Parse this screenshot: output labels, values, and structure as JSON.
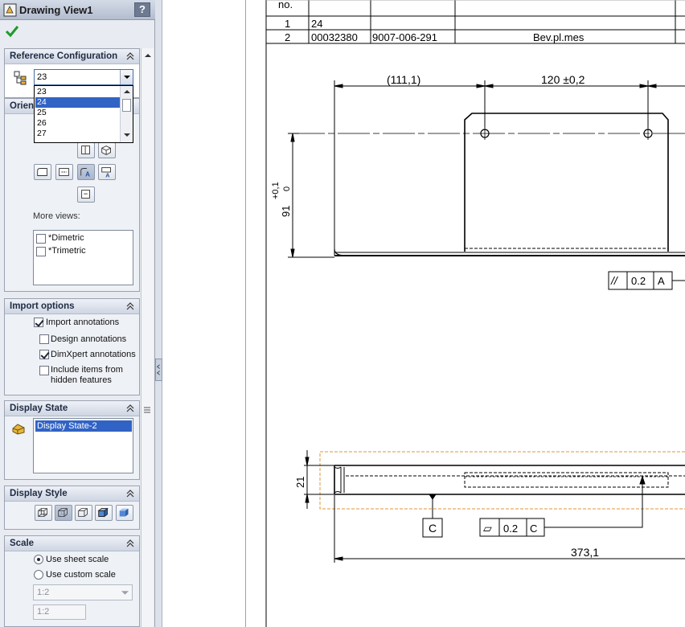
{
  "property_manager": {
    "title": "Drawing View1",
    "help": "?",
    "reference_configuration": {
      "header": "Reference Configuration",
      "selected": "23",
      "options": [
        "23",
        "24",
        "25",
        "26",
        "27"
      ],
      "highlighted": "24"
    },
    "orientation": {
      "header": "Orien",
      "more_views_label": "More views:",
      "more_views": [
        "*Dimetric",
        "*Trimetric"
      ]
    },
    "import_options": {
      "header": "Import options",
      "items": [
        {
          "label": "Import annotations",
          "checked": true
        },
        {
          "label": "Design annotations",
          "checked": false
        },
        {
          "label": "DimXpert annotations",
          "checked": true
        },
        {
          "label": "Include items from",
          "label2": "hidden features",
          "checked": false
        }
      ]
    },
    "display_state": {
      "header": "Display State",
      "items": [
        "Display State-2"
      ]
    },
    "display_style": {
      "header": "Display Style"
    },
    "scale": {
      "header": "Scale",
      "options": [
        {
          "label": "Use sheet scale",
          "selected": true
        },
        {
          "label": "Use custom scale",
          "selected": false
        }
      ],
      "combo_value": "1:2",
      "text_value": "1:2"
    }
  },
  "drawing": {
    "bom": {
      "header_no": "no.",
      "rows": [
        {
          "no": "1",
          "part": "24",
          "item": "",
          "desc": ""
        },
        {
          "no": "2",
          "part": "00032380",
          "item": "9007-006-291",
          "desc": "Bev.pl.mes"
        }
      ]
    },
    "dims": {
      "ref_111": "(111,1)",
      "dim_120": "120 ±0,2",
      "dim_91": "91",
      "tol_plus": "+0,1",
      "tol_zero": "0",
      "dim_21": "21",
      "dim_373": "373,1"
    },
    "parallelism_frame": {
      "symbol": "//",
      "value": "0.2",
      "datum": "A"
    },
    "flatness_frame": {
      "symbol": "▱",
      "value": "0.2",
      "datum": "C"
    },
    "datum_c": "C"
  },
  "colors": {
    "selection": "#3163c5",
    "highlight_border": "#e0953a",
    "panel_header_text": "#1e2b42"
  }
}
